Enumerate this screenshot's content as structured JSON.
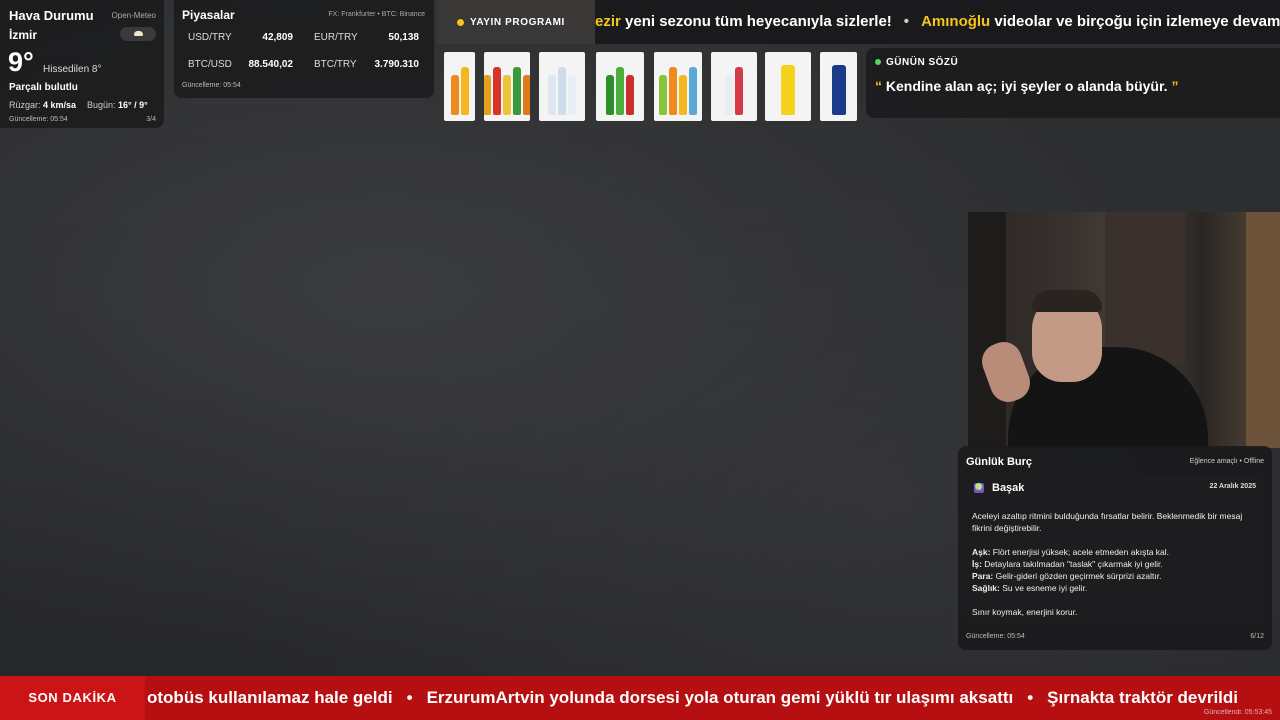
{
  "weather": {
    "title": "Hava Durumu",
    "source": "Open-Meteo",
    "city": "İzmir",
    "temp": "9°",
    "feels": "Hissedilen 8°",
    "condition": "Parçalı bulutlu",
    "wind_label": "Rüzgar:",
    "wind_value": "4 km/sa",
    "today_label": "Bugün:",
    "today_value": "16° / 9°",
    "updated": "Güncelleme: 05:54",
    "page": "3/4"
  },
  "markets": {
    "title": "Piyasalar",
    "source": "FX: Frankfurter • BTC: Binance",
    "rates": [
      {
        "label": "USD/TRY",
        "value": "42,809"
      },
      {
        "label": "EUR/TRY",
        "value": "50,138"
      },
      {
        "label": "BTC/USD",
        "value": "88.540,02"
      },
      {
        "label": "BTC/TRY",
        "value": "3.790.310"
      }
    ],
    "updated": "Güncelleme: 05:54"
  },
  "program": {
    "badge": "YAYIN PROGRAMI",
    "item1_highlight": "ezir",
    "item1_text": " yeni sezonu tüm heyecanıyla sizlerle!",
    "item2_highlight": "Amınoğlu",
    "item2_text": " videolar ve birçoğu için izlemeye devam",
    "bullet": "•"
  },
  "quote": {
    "tag": "GÜNÜN SÖZÜ",
    "open": "“",
    "text": " Kendine alan aç; iyi şeyler o alanda büyür. ",
    "close": "”"
  },
  "products": [
    {
      "name": "orange-soda-product",
      "colors": [
        "#f08a1c",
        "#f5b71d"
      ]
    },
    {
      "name": "mixed-soda-pack-product",
      "colors": [
        "#e0a21a",
        "#d8352a",
        "#f0c23a",
        "#3a9a3a",
        "#e07a1a"
      ]
    },
    {
      "name": "water-bottles-product",
      "colors": [
        "#dfe8f2",
        "#cfdcea",
        "#e7eef6"
      ]
    },
    {
      "name": "lime-soda-pack-product",
      "colors": [
        "#2e8f2e",
        "#4cae3a",
        "#c8302a"
      ]
    },
    {
      "name": "fruit-soda-pack-product",
      "colors": [
        "#8ac43a",
        "#f08a1c",
        "#f5b71d",
        "#5aa8d8"
      ]
    },
    {
      "name": "sparkling-water-product",
      "colors": [
        "#e8eef4",
        "#d43a4a"
      ]
    },
    {
      "name": "lemon-soda-product",
      "colors": [
        "#f5d21d"
      ]
    },
    {
      "name": "energy-drink-can-product",
      "colors": [
        "#1a3a8a"
      ]
    }
  ],
  "horoscope": {
    "title": "Günlük Burç",
    "meta": "Eğlence amaçlı • Offline",
    "sign_icon": "♍",
    "sign": "Başak",
    "date": "22 Aralık 2025",
    "intro": "Aceleyi azaltıp ritmini bulduğunda fırsatlar belirir. Beklenmedik bir mesaj fikrini değiştirebilir.",
    "love_label": "Aşk:",
    "love": " Flört enerjisi yüksek; acele etmeden akışta kal.",
    "work_label": "İş:",
    "work": " Detaylara takılmadan \"taslak\" çıkarmak iyi gelir.",
    "money_label": "Para:",
    "money": " Gelir-gideri gözden geçirmek sürprizi azaltır.",
    "health_label": "Sağlık:",
    "health": " Su ve esneme iyi gelir.",
    "closing": "Sınır koymak, enerjini korur.",
    "updated": "Güncelleme: 05:54",
    "page": "6/12"
  },
  "breaking": {
    "label": "SON DAKİKA",
    "item1": "otobüs kullanılamaz hale geldi",
    "item2": "ErzurumArtvin yolunda dorsesi yola oturan gemi yüklü tır ulaşımı aksattı",
    "item3": "Şırnakta traktör devrildi",
    "bullet": "•",
    "updated": "Güncellendi: 05:53:45"
  },
  "colors": {
    "accent": "#f5c518",
    "breaking": "#b50f12",
    "live_dot": "#4cd964"
  }
}
